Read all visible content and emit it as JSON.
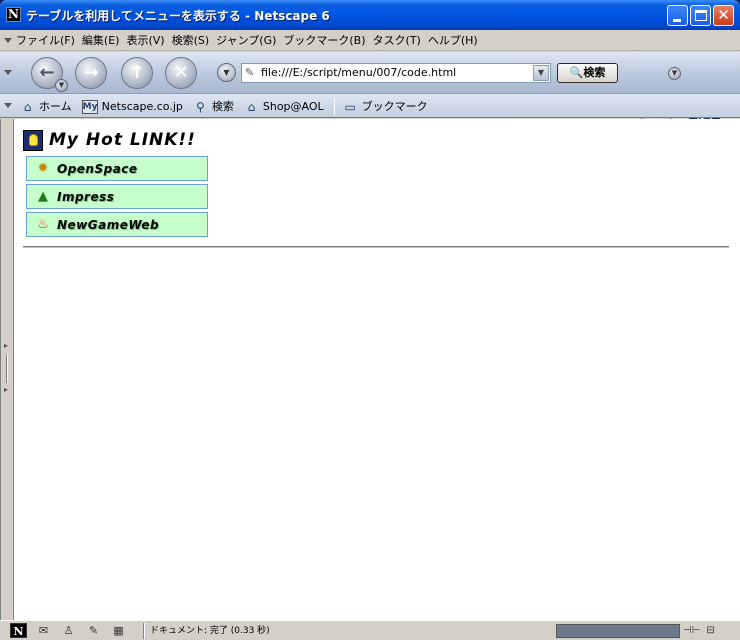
{
  "window": {
    "title": "テーブルを利用してメニューを表示する - Netscape 6",
    "app_icon": "N"
  },
  "menubar": {
    "items": [
      {
        "label": "ファイル(F)"
      },
      {
        "label": "編集(E)"
      },
      {
        "label": "表示(V)"
      },
      {
        "label": "検索(S)"
      },
      {
        "label": "ジャンプ(G)"
      },
      {
        "label": "ブックマーク(B)"
      },
      {
        "label": "タスク(T)"
      },
      {
        "label": "ヘルプ(H)"
      }
    ]
  },
  "navbar": {
    "url": "file:///E:/script/menu/007/code.html",
    "search_label": "検索",
    "logo": "N"
  },
  "personal_toolbar": {
    "home_label": "ホーム",
    "my_badge": "My",
    "netscape_label": "Netscape.co.jp",
    "search_label": "検索",
    "shop_label": "Shop@AOL",
    "bookmarks_label": "ブックマーク"
  },
  "page": {
    "heading": "My Hot LINK!!",
    "links": [
      {
        "label": "OpenSpace",
        "icon": "sun-icon"
      },
      {
        "label": "Impress",
        "icon": "tree-icon"
      },
      {
        "label": "NewGameWeb",
        "icon": "fire-icon"
      }
    ],
    "link_bg": "#c6ffcc",
    "link_border": "#6aa2d4"
  },
  "statusbar": {
    "text": "ドキュメント: 完了 (0.33 秒)"
  },
  "colors": {
    "titlebar": "#0054e3",
    "progress": "#6f7a8c"
  }
}
